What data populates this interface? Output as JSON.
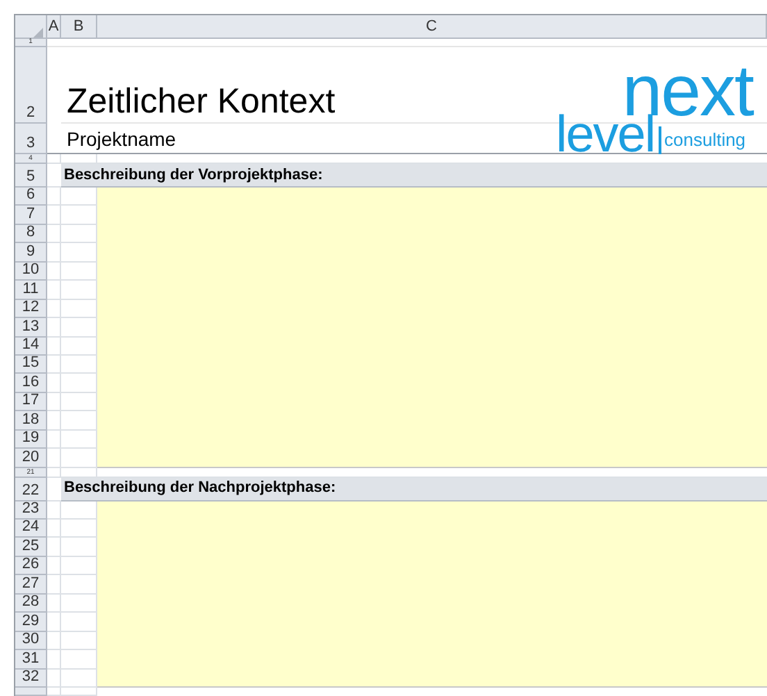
{
  "columns": [
    "A",
    "B",
    "C"
  ],
  "title": "Zeitlicher Kontext",
  "project_name": "Projektname",
  "logo": {
    "top": "next",
    "left": "level",
    "right": "consulting"
  },
  "top_rows": [
    "1",
    "2",
    "3",
    "4"
  ],
  "sections": [
    {
      "heading_row": "5",
      "heading": "Beschreibung der Vorprojektphase:",
      "rows": [
        "6",
        "7",
        "8",
        "9",
        "10",
        "11",
        "12",
        "13",
        "14",
        "15",
        "16",
        "17",
        "18",
        "19",
        "20"
      ]
    },
    {
      "spacer_row": "21",
      "heading_row": "22",
      "heading": "Beschreibung der Nachprojektphase:",
      "rows": [
        "23",
        "24",
        "25",
        "26",
        "27",
        "28",
        "29",
        "30",
        "31",
        "32"
      ]
    }
  ]
}
